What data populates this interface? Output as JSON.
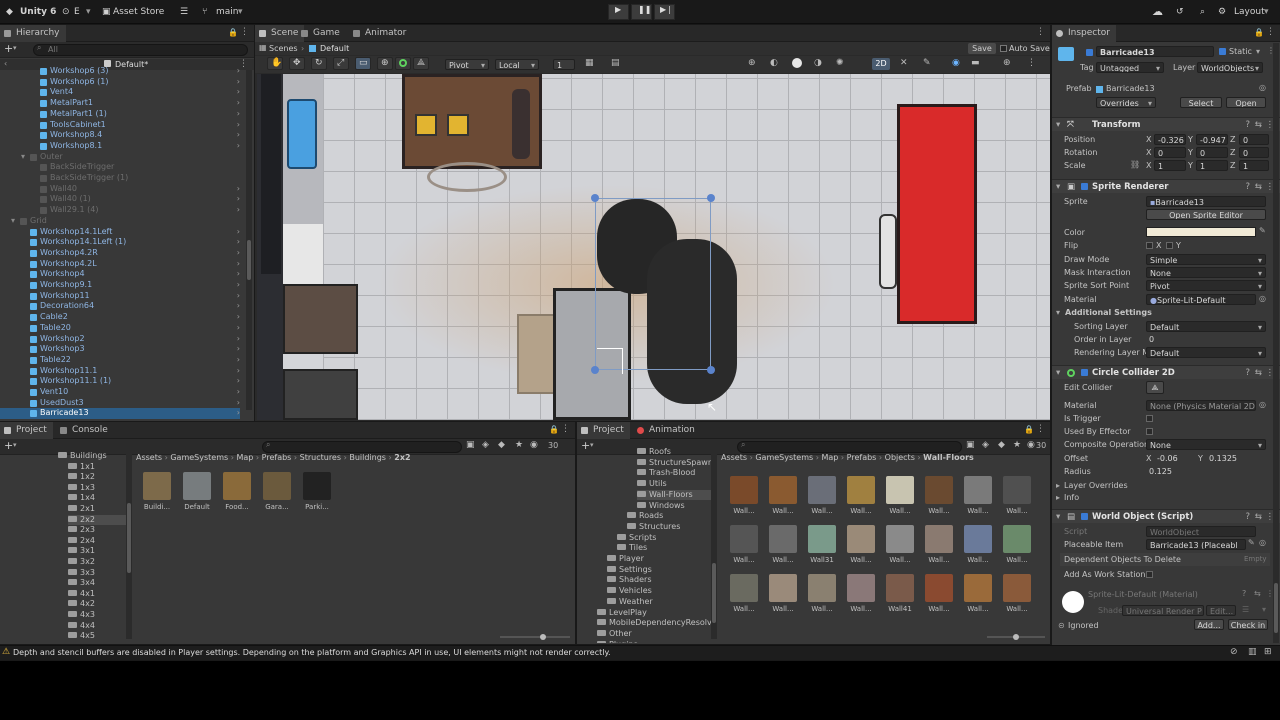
{
  "topbar": {
    "app": "Unity 6",
    "account": "E",
    "asset_store": "Asset Store",
    "branch": "main",
    "layout": "Layout"
  },
  "hierarchy": {
    "tab": "Hierarchy",
    "search_placeholder": "All",
    "scene": "Default*",
    "rows": [
      {
        "label": "Workshop6 (3)",
        "indent": 3,
        "dim": false
      },
      {
        "label": "Workshop6 (1)",
        "indent": 3,
        "dim": false
      },
      {
        "label": "Vent4",
        "indent": 3,
        "dim": false
      },
      {
        "label": "MetalPart1",
        "indent": 3,
        "dim": false
      },
      {
        "label": "MetalPart1 (1)",
        "indent": 3,
        "dim": false
      },
      {
        "label": "ToolsCabinet1",
        "indent": 3,
        "dim": false
      },
      {
        "label": "Workshop8.4",
        "indent": 3,
        "dim": false
      },
      {
        "label": "Workshop8.1",
        "indent": 3,
        "dim": false
      },
      {
        "label": "Outer",
        "indent": 2,
        "dim": true
      },
      {
        "label": "BackSideTrigger",
        "indent": 3,
        "dim": true
      },
      {
        "label": "BackSideTrigger (1)",
        "indent": 3,
        "dim": true
      },
      {
        "label": "Wall40",
        "indent": 3,
        "dim": true
      },
      {
        "label": "Wall40 (1)",
        "indent": 3,
        "dim": true
      },
      {
        "label": "Wall29.1 (4)",
        "indent": 3,
        "dim": true
      },
      {
        "label": "Grid",
        "indent": 1,
        "dim": true
      },
      {
        "label": "Workshop14.1Left",
        "indent": 2,
        "dim": false
      },
      {
        "label": "Workshop14.1Left (1)",
        "indent": 2,
        "dim": false
      },
      {
        "label": "Workshop4.2R",
        "indent": 2,
        "dim": false
      },
      {
        "label": "Workshop4.2L",
        "indent": 2,
        "dim": false
      },
      {
        "label": "Workshop4",
        "indent": 2,
        "dim": false
      },
      {
        "label": "Workshop9.1",
        "indent": 2,
        "dim": false
      },
      {
        "label": "Workshop11",
        "indent": 2,
        "dim": false
      },
      {
        "label": "Decoration64",
        "indent": 2,
        "dim": false
      },
      {
        "label": "Cable2",
        "indent": 2,
        "dim": false
      },
      {
        "label": "Table20",
        "indent": 2,
        "dim": false
      },
      {
        "label": "Workshop2",
        "indent": 2,
        "dim": false
      },
      {
        "label": "Workshop3",
        "indent": 2,
        "dim": false
      },
      {
        "label": "Table22",
        "indent": 2,
        "dim": false
      },
      {
        "label": "Workshop11.1",
        "indent": 2,
        "dim": false
      },
      {
        "label": "Workshop11.1 (1)",
        "indent": 2,
        "dim": false
      },
      {
        "label": "Vent10",
        "indent": 2,
        "dim": false
      },
      {
        "label": "UsedDust3",
        "indent": 2,
        "dim": false
      },
      {
        "label": "Barricade13",
        "indent": 2,
        "dim": false,
        "selected": true
      }
    ]
  },
  "scene_panel": {
    "tabs": [
      "Scene",
      "Game",
      "Animator"
    ],
    "scenes_label": "Scenes",
    "default_label": "Default",
    "save": "Save",
    "autosave": "Auto Save",
    "pivot": "Pivot",
    "local": "Local",
    "grid_value": "1",
    "mode_2d": "2D"
  },
  "project_left": {
    "tabs": [
      "Project",
      "Console"
    ],
    "count": "30",
    "breadcrumb": [
      "Assets",
      "GameSystems",
      "Map",
      "Prefabs",
      "Structures",
      "Buildings",
      "2x2"
    ],
    "tree": [
      {
        "label": "Buildings",
        "indent": 0
      },
      {
        "label": "1x1",
        "indent": 1
      },
      {
        "label": "1x2",
        "indent": 1
      },
      {
        "label": "1x3",
        "indent": 1
      },
      {
        "label": "1x4",
        "indent": 1
      },
      {
        "label": "2x1",
        "indent": 1
      },
      {
        "label": "2x2",
        "indent": 1,
        "selected": true
      },
      {
        "label": "2x3",
        "indent": 1
      },
      {
        "label": "2x4",
        "indent": 1
      },
      {
        "label": "3x1",
        "indent": 1
      },
      {
        "label": "3x2",
        "indent": 1
      },
      {
        "label": "3x3",
        "indent": 1
      },
      {
        "label": "3x4",
        "indent": 1
      },
      {
        "label": "4x1",
        "indent": 1
      },
      {
        "label": "4x2",
        "indent": 1
      },
      {
        "label": "4x3",
        "indent": 1
      },
      {
        "label": "4x4",
        "indent": 1
      },
      {
        "label": "4x5",
        "indent": 1
      }
    ],
    "assets": [
      {
        "label": "Buildi...",
        "color": "#7d6a4a"
      },
      {
        "label": "Default",
        "color": "#777c7e"
      },
      {
        "label": "Food...",
        "color": "#8a6a3a"
      },
      {
        "label": "Gara...",
        "color": "#6b5a3d"
      },
      {
        "label": "Parki...",
        "color": "#222222"
      }
    ]
  },
  "project_right": {
    "tabs": [
      "Project",
      "Animation"
    ],
    "count": "30",
    "breadcrumb": [
      "Assets",
      "GameSystems",
      "Map",
      "Prefabs",
      "Objects",
      "Wall-Floors"
    ],
    "tree": [
      {
        "label": "Roofs",
        "indent": 3
      },
      {
        "label": "StructureSpawne",
        "indent": 3
      },
      {
        "label": "Trash-Blood",
        "indent": 3
      },
      {
        "label": "Utils",
        "indent": 3
      },
      {
        "label": "Wall-Floors",
        "indent": 3,
        "selected": true
      },
      {
        "label": "Windows",
        "indent": 3
      },
      {
        "label": "Roads",
        "indent": 2
      },
      {
        "label": "Structures",
        "indent": 2
      },
      {
        "label": "Scripts",
        "indent": 1
      },
      {
        "label": "Tiles",
        "indent": 1
      },
      {
        "label": "Player",
        "indent": 0
      },
      {
        "label": "Settings",
        "indent": 0
      },
      {
        "label": "Shaders",
        "indent": 0
      },
      {
        "label": "Vehicles",
        "indent": 0
      },
      {
        "label": "Weather",
        "indent": 0
      },
      {
        "label": "LevelPlay",
        "indent": -1
      },
      {
        "label": "MobileDependencyResolve",
        "indent": -1
      },
      {
        "label": "Other",
        "indent": -1
      },
      {
        "label": "Plugins",
        "indent": -1
      }
    ],
    "assets": [
      {
        "label": "Wall...",
        "color": "#7a4a2a"
      },
      {
        "label": "Wall...",
        "color": "#8a5a30"
      },
      {
        "label": "Wall...",
        "color": "#6a6e78"
      },
      {
        "label": "Wall...",
        "color": "#a08040"
      },
      {
        "label": "Wall...",
        "color": "#c8c4b0"
      },
      {
        "label": "Wall...",
        "color": "#6a4a30"
      },
      {
        "label": "Wall...",
        "color": "#7a7a7a"
      },
      {
        "label": "Wall...",
        "color": "#505050"
      },
      {
        "label": "Wall...",
        "color": "#555555"
      },
      {
        "label": "Wall...",
        "color": "#6a6a6a"
      },
      {
        "label": "Wall31",
        "color": "#7a9a8a"
      },
      {
        "label": "Wall...",
        "color": "#9a8a78"
      },
      {
        "label": "Wall...",
        "color": "#8a8a8a"
      },
      {
        "label": "Wall...",
        "color": "#8a7a70"
      },
      {
        "label": "Wall...",
        "color": "#6a7a9a"
      },
      {
        "label": "Wall...",
        "color": "#6a8a6a"
      },
      {
        "label": "Wall...",
        "color": "#6a6a60"
      },
      {
        "label": "Wall...",
        "color": "#9a8a7a"
      },
      {
        "label": "Wall...",
        "color": "#8a8070"
      },
      {
        "label": "Wall...",
        "color": "#8a7878"
      },
      {
        "label": "Wall41",
        "color": "#7a5a4a"
      },
      {
        "label": "Wall...",
        "color": "#8a4a30"
      },
      {
        "label": "Wall...",
        "color": "#9a6a3a"
      },
      {
        "label": "Wall...",
        "color": "#8a5a3a"
      }
    ]
  },
  "inspector": {
    "tab": "Inspector",
    "object_name": "Barricade13",
    "static_label": "Static",
    "tag_label": "Tag",
    "tag_value": "Untagged",
    "layer_label": "Layer",
    "layer_value": "WorldObjects",
    "prefab_label": "Prefab",
    "prefab_value": "Barricade13",
    "overrides": "Overrides",
    "select": "Select",
    "open": "Open",
    "transform": {
      "title": "Transform",
      "position_label": "Position",
      "pos_x": "-0.326",
      "pos_y": "-0.947",
      "pos_z": "0",
      "rotation_label": "Rotation",
      "rot_x": "0",
      "rot_y": "0",
      "rot_z": "0",
      "scale_label": "Scale",
      "sc_x": "1",
      "sc_y": "1",
      "sc_z": "1"
    },
    "sprite_renderer": {
      "title": "Sprite Renderer",
      "sprite_label": "Sprite",
      "sprite_value": "Barricade13",
      "open_editor": "Open Sprite Editor",
      "color_label": "Color",
      "flip_label": "Flip",
      "flip_x": "X",
      "flip_y": "Y",
      "draw_mode_label": "Draw Mode",
      "draw_mode": "Simple",
      "mask_label": "Mask Interaction",
      "mask_value": "None",
      "sort_point_label": "Sprite Sort Point",
      "sort_point": "Pivot",
      "material_label": "Material",
      "material": "Sprite-Lit-Default",
      "additional": "Additional Settings",
      "sorting_layer_label": "Sorting Layer",
      "sorting_layer": "Default",
      "order_label": "Order in Layer",
      "order_value": "0",
      "rendering_layer_label": "Rendering Layer M",
      "rendering_layer": "Default"
    },
    "circle_collider": {
      "title": "Circle Collider 2D",
      "edit_label": "Edit Collider",
      "material_label": "Material",
      "material": "None (Physics Material 2D)",
      "trigger_label": "Is Trigger",
      "effector_label": "Used By Effector",
      "composite_label": "Composite Operation",
      "composite": "None",
      "offset_label": "Offset",
      "off_x": "-0.06",
      "off_y": "0.1325",
      "radius_label": "Radius",
      "radius": "0.125",
      "layer_overrides": "Layer Overrides",
      "info": "Info"
    },
    "world_object": {
      "title": "World Object (Script)",
      "script_label": "Script",
      "script": "WorldObject",
      "placeable_label": "Placeable Item",
      "placeable": "Barricade13 (Placeabl",
      "dependent_label": "Dependent Objects To Delete",
      "dependent_value": "Empty",
      "work_station_label": "Add As Work Station"
    },
    "material_preview": {
      "title": "Sprite-Lit-Default (Material)",
      "shader_label": "Shader",
      "shader": "Universal Render P",
      "edit": "Edit..."
    },
    "ignored": "Ignored",
    "add": "Add...",
    "check_in": "Check in"
  },
  "status": {
    "warning": "Depth and stencil buffers are disabled in Player settings. Depending on the platform and Graphics API in use, UI elements might not render correctly."
  },
  "colors": {
    "accent": "#2c5d87",
    "prefab_blue": "#5fb5ec",
    "sprite_color": "#f1ead6"
  }
}
